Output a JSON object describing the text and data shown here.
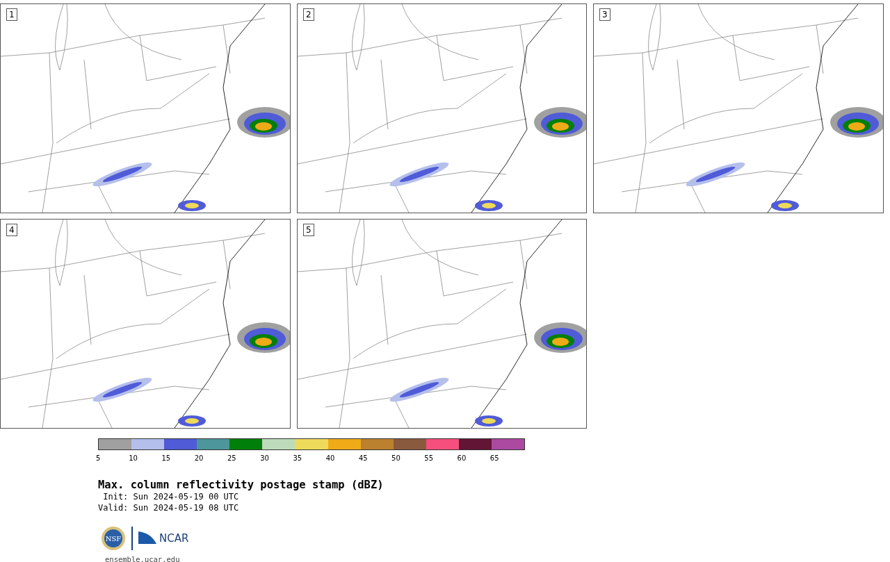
{
  "panels": [
    {
      "label": "1"
    },
    {
      "label": "2"
    },
    {
      "label": "3"
    },
    {
      "label": "4"
    },
    {
      "label": "5"
    }
  ],
  "colorbar": {
    "segments": [
      {
        "color": "#a0a0a0"
      },
      {
        "color": "#b4bfec"
      },
      {
        "color": "#505bd8"
      },
      {
        "color": "#4d969b"
      },
      {
        "color": "#00800a"
      },
      {
        "color": "#bddbbb"
      },
      {
        "color": "#eeda5a"
      },
      {
        "color": "#efaa17"
      },
      {
        "color": "#bc812f"
      },
      {
        "color": "#8a5a3f"
      },
      {
        "color": "#f74f7d"
      },
      {
        "color": "#621535"
      },
      {
        "color": "#ac4aa1"
      }
    ],
    "ticks": [
      "5",
      "10",
      "15",
      "20",
      "25",
      "30",
      "35",
      "40",
      "45",
      "50",
      "55",
      "60",
      "65"
    ]
  },
  "title": "Max. column reflectivity postage stamp (dBZ)",
  "init": " Init: Sun 2024-05-19 00 UTC",
  "valid": "Valid: Sun 2024-05-19 08 UTC",
  "logos": {
    "seal": "NSF",
    "wordmark": "NCAR"
  },
  "link": "ensemble.ucar.edu"
}
